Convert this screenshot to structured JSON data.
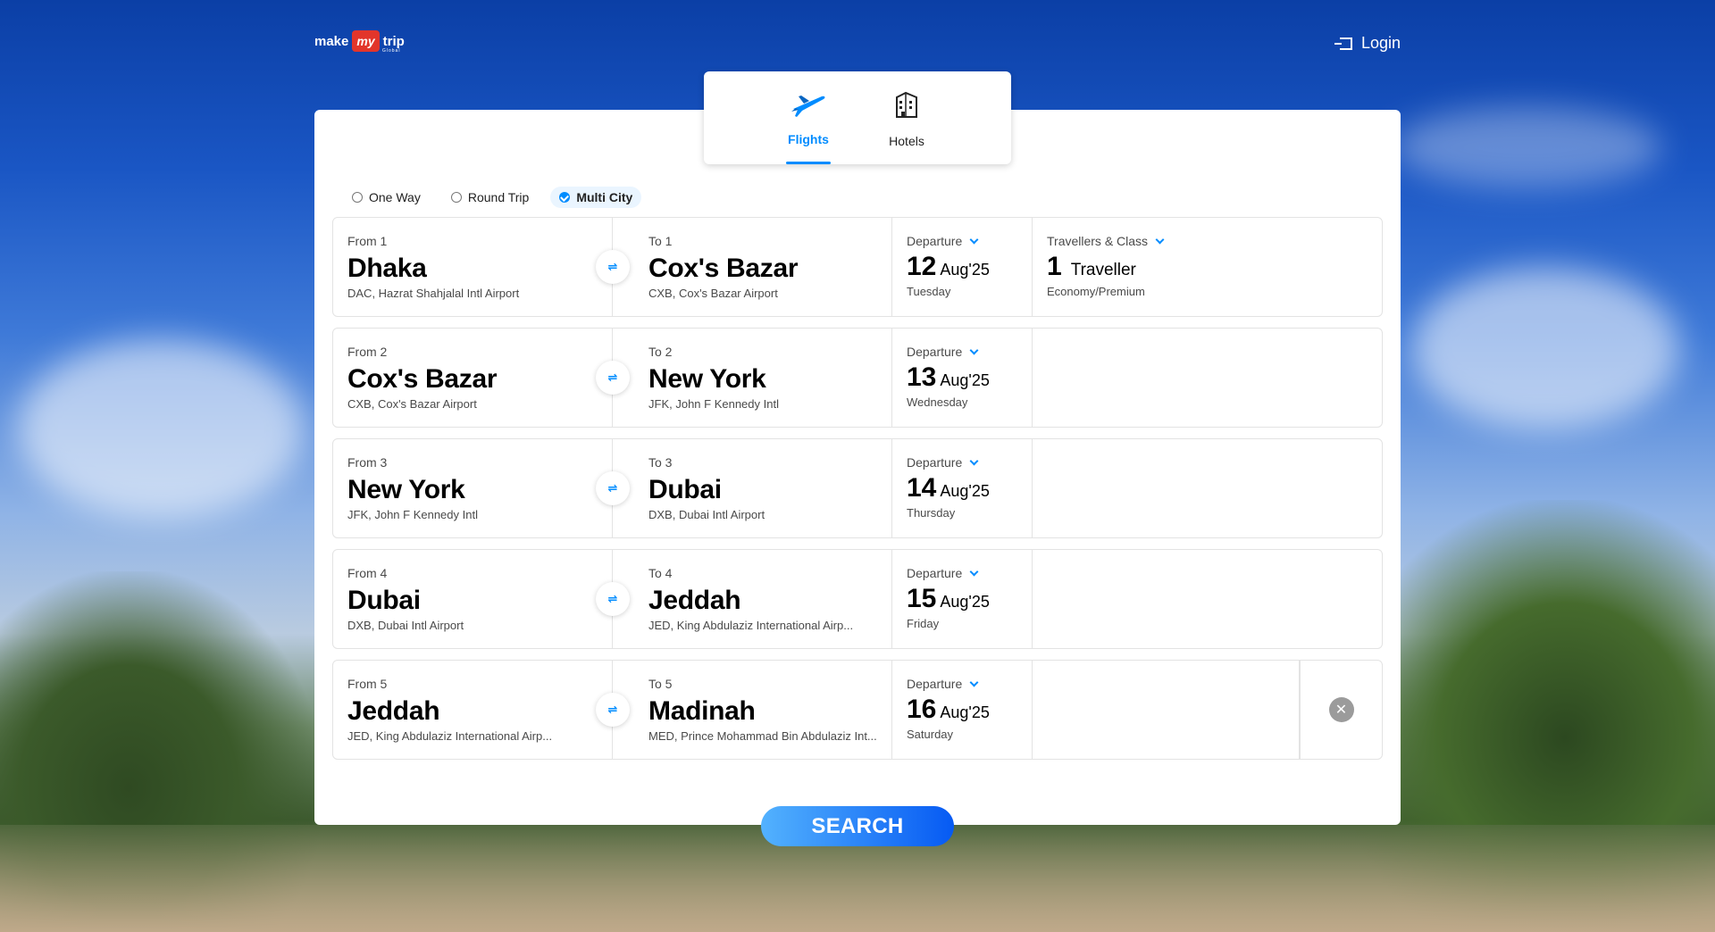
{
  "header": {
    "logo": {
      "make": "make",
      "my": "my",
      "trip": "trip",
      "sub": "Global"
    },
    "login_label": "Login"
  },
  "tabs": [
    {
      "label": "Flights",
      "icon": "plane-icon",
      "active": true
    },
    {
      "label": "Hotels",
      "icon": "building-icon",
      "active": false
    }
  ],
  "trip_types": [
    {
      "label": "One Way",
      "selected": false
    },
    {
      "label": "Round Trip",
      "selected": false
    },
    {
      "label": "Multi City",
      "selected": true
    }
  ],
  "legs": [
    {
      "from_label": "From 1",
      "from_city": "Dhaka",
      "from_sub": "DAC, Hazrat Shahjalal Intl Airport",
      "to_label": "To 1",
      "to_city": "Cox's Bazar",
      "to_sub": "CXB, Cox's Bazar Airport",
      "dep_label": "Departure",
      "day": "12",
      "mon": "Aug'25",
      "weekday": "Tuesday"
    },
    {
      "from_label": "From 2",
      "from_city": "Cox's Bazar",
      "from_sub": "CXB, Cox's Bazar Airport",
      "to_label": "To 2",
      "to_city": "New York",
      "to_sub": "JFK, John F Kennedy Intl",
      "dep_label": "Departure",
      "day": "13",
      "mon": "Aug'25",
      "weekday": "Wednesday"
    },
    {
      "from_label": "From 3",
      "from_city": "New York",
      "from_sub": "JFK, John F Kennedy Intl",
      "to_label": "To 3",
      "to_city": "Dubai",
      "to_sub": "DXB, Dubai Intl Airport",
      "dep_label": "Departure",
      "day": "14",
      "mon": "Aug'25",
      "weekday": "Thursday"
    },
    {
      "from_label": "From 4",
      "from_city": "Dubai",
      "from_sub": "DXB, Dubai Intl Airport",
      "to_label": "To 4",
      "to_city": "Jeddah",
      "to_sub": "JED, King Abdulaziz International Airp...",
      "dep_label": "Departure",
      "day": "15",
      "mon": "Aug'25",
      "weekday": "Friday"
    },
    {
      "from_label": "From 5",
      "from_city": "Jeddah",
      "from_sub": "JED, King Abdulaziz International Airp...",
      "to_label": "To 5",
      "to_city": "Madinah",
      "to_sub": "MED, Prince Mohammad Bin Abdulaziz Int...",
      "dep_label": "Departure",
      "day": "16",
      "mon": "Aug'25",
      "weekday": "Saturday"
    }
  ],
  "travellers": {
    "label": "Travellers & Class",
    "count": "1",
    "word": "Traveller",
    "class": "Economy/Premium"
  },
  "swap_symbol": "⇌",
  "remove_symbol": "✕",
  "search_label": "SEARCH",
  "colors": {
    "accent": "#008cff",
    "brand_red": "#e2352b"
  }
}
